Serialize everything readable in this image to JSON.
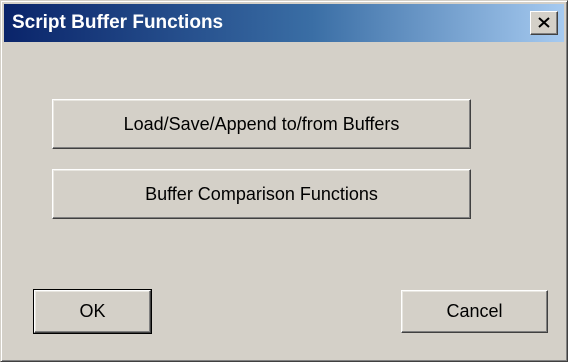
{
  "window": {
    "title": "Script Buffer Functions",
    "close_icon": "close-icon"
  },
  "actions": {
    "load_save_label": "Load/Save/Append to/from Buffers",
    "compare_label": "Buffer Comparison Functions"
  },
  "footer": {
    "ok_label": "OK",
    "cancel_label": "Cancel"
  },
  "colors": {
    "titlebar_start": "#0a246a",
    "titlebar_end": "#a6caf0",
    "face": "#d4d0c8"
  }
}
